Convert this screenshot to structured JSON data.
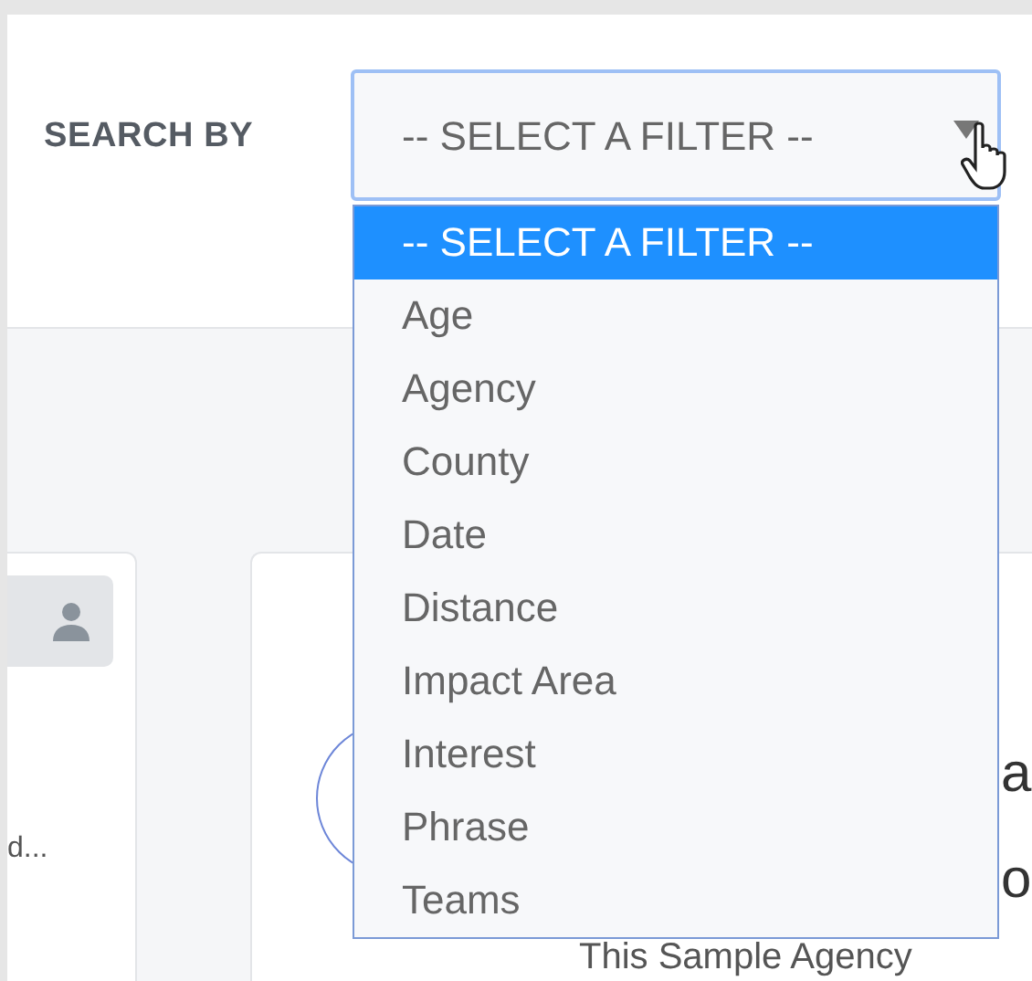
{
  "search": {
    "label": "SEARCH BY",
    "value": "-- SELECT A FILTER --",
    "expanded": true,
    "options": [
      {
        "label": "-- SELECT A FILTER --",
        "selected": true
      },
      {
        "label": "Age",
        "selected": false
      },
      {
        "label": "Agency",
        "selected": false
      },
      {
        "label": "County",
        "selected": false
      },
      {
        "label": "Date",
        "selected": false
      },
      {
        "label": "Distance",
        "selected": false
      },
      {
        "label": "Impact Area",
        "selected": false
      },
      {
        "label": "Interest",
        "selected": false
      },
      {
        "label": "Phrase",
        "selected": false
      },
      {
        "label": "Teams",
        "selected": false
      }
    ]
  },
  "cards": [
    {
      "kind": "profile",
      "snippet": "d..."
    },
    {
      "kind": "agency",
      "fragments": [
        "a",
        "o"
      ],
      "caption": "This Sample Agency"
    }
  ]
}
